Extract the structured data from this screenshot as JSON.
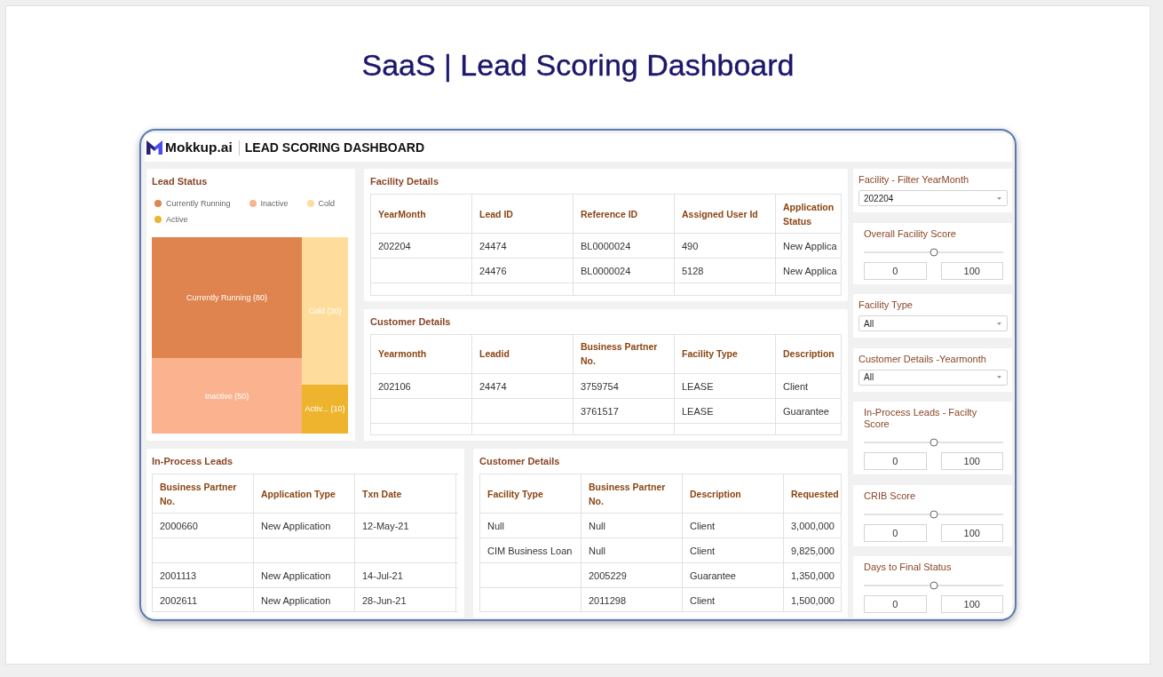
{
  "page_title": "SaaS | Lead Scoring Dashboard",
  "dashboard": {
    "brand": "Mokkup.ai",
    "title": "LEAD SCORING DASHBOARD",
    "lead_status": {
      "title": "Lead Status",
      "legend": [
        {
          "label": "Currently Running",
          "color": "#e0844f"
        },
        {
          "label": "Inactive",
          "color": "#fbb38f"
        },
        {
          "label": "Cold",
          "color": "#fedd9c"
        },
        {
          "label": "Active",
          "color": "#eeb42d"
        }
      ],
      "treemap": [
        {
          "tiles": [
            {
              "label": "Currently Running (80)",
              "color": "#e0844f"
            },
            {
              "label": "Inactive (50)",
              "color": "#fbb38f"
            }
          ]
        },
        {
          "tiles": [
            {
              "label": "Cold (30)",
              "color": "#fedd9c"
            },
            {
              "label": "Activ... (10)",
              "color": "#eeb42d"
            }
          ]
        }
      ]
    },
    "facility_details": {
      "title": "Facility Details",
      "columns": [
        "YearMonth",
        "Lead ID",
        "Reference ID",
        "Assigned User Id",
        "Application Status"
      ],
      "rows": [
        [
          "202204",
          "24474",
          "BL0000024",
          "490",
          "New Applica"
        ],
        [
          null,
          "24476",
          "BL0000024",
          "5128",
          "New Applica"
        ],
        [
          null,
          null,
          null,
          null,
          null
        ]
      ]
    },
    "customer_details": {
      "title": "Customer Details",
      "columns": [
        "Yearmonth",
        "Leadid",
        "Business Partner No.",
        "Facility Type",
        "Description"
      ],
      "rows": [
        [
          "202106",
          "24474",
          "3759754",
          "LEASE",
          "Client"
        ],
        [
          null,
          null,
          "3761517",
          "LEASE",
          "Guarantee"
        ],
        [
          null,
          null,
          null,
          null,
          null
        ]
      ]
    },
    "in_process_leads": {
      "title": "In-Process Leads",
      "columns": [
        "Business Partner No.",
        "Application Type",
        "Txn Date"
      ],
      "rows": [
        [
          "2000660",
          "New Application",
          "12-May-21"
        ],
        [
          null,
          null,
          null
        ],
        [
          "2001113",
          "New Application",
          "14-Jul-21"
        ],
        [
          "2002611",
          "New Application",
          "28-Jun-21"
        ]
      ]
    },
    "customer_details_lower": {
      "title": "Customer Details",
      "columns": [
        "Facility Type",
        "Business Partner No.",
        "Description",
        "Requested"
      ],
      "rows": [
        [
          "Null",
          "Null",
          "Client",
          "3,000,000"
        ],
        [
          "CIM Business Loan",
          "Null",
          "Client",
          "9,825,000"
        ],
        [
          null,
          "2005229",
          "Guarantee",
          "1,350,000"
        ],
        [
          null,
          "2011298",
          "Client",
          "1,500,000"
        ]
      ]
    },
    "filters": [
      {
        "kind": "dropdown",
        "title": "Facility - Filter YearMonth",
        "value": "202204"
      },
      {
        "kind": "range",
        "title": "Overall Facility Score",
        "level": 0.5,
        "min_value": "0",
        "max_value": "100"
      },
      {
        "kind": "dropdown",
        "title": "Facility Type",
        "value": "All"
      },
      {
        "kind": "dropdown",
        "title": "Customer Details -Yearmonth",
        "value": "All"
      },
      {
        "kind": "range",
        "title": "In-Process Leads - Facilty Score",
        "level": 0.5,
        "min_value": "0",
        "max_value": "100"
      },
      {
        "kind": "range",
        "title": "CRIB Score",
        "level": 0.5,
        "min_value": "0",
        "max_value": "100"
      },
      {
        "kind": "range",
        "title": "Days to Final Status",
        "level": 0.5,
        "min_value": "0",
        "max_value": "100"
      }
    ]
  }
}
